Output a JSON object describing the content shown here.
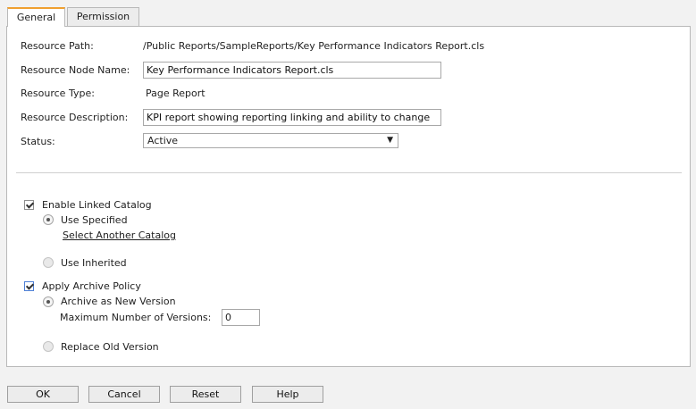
{
  "tabs": [
    {
      "label": "General",
      "active": true
    },
    {
      "label": "Permission",
      "active": false
    }
  ],
  "form": {
    "resource_path_label": "Resource Path:",
    "resource_path_value": "/Public Reports/SampleReports/Key Performance Indicators Report.cls",
    "node_name_label": "Resource Node Name:",
    "node_name_value": "Key Performance Indicators Report.cls",
    "type_label": "Resource Type:",
    "type_value": "Page Report",
    "description_label": "Resource Description:",
    "description_value": "KPI report showing reporting linking and ability to change",
    "status_label": "Status:",
    "status_value": "Active"
  },
  "linked_catalog": {
    "enable_label": "Enable Linked Catalog",
    "enabled": true,
    "use_specified_label": "Use Specified",
    "select_another_label": "Select Another Catalog",
    "use_inherited_label": "Use Inherited"
  },
  "archive": {
    "apply_label": "Apply Archive Policy",
    "applied": true,
    "new_version_label": "Archive as New Version",
    "max_versions_label": "Maximum Number of Versions:",
    "max_versions_value": "0",
    "replace_label": "Replace Old Version"
  },
  "buttons": {
    "ok": "OK",
    "cancel": "Cancel",
    "reset": "Reset",
    "help": "Help"
  }
}
